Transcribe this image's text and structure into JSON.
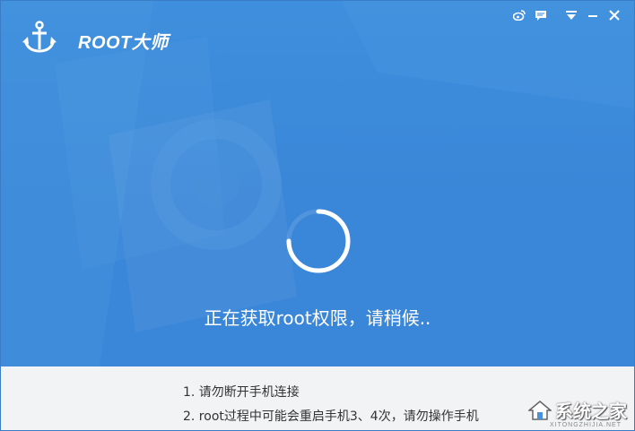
{
  "app": {
    "title": "ROOT大师"
  },
  "titlebar": {
    "controls": [
      "weibo-icon",
      "feedback-icon",
      "menu-icon",
      "minimize-icon",
      "close-icon"
    ]
  },
  "main": {
    "status_text": "正在获取root权限，请稍候.."
  },
  "tips": {
    "items": [
      "1. 请勿断开手机连接",
      "2. root过程中可能会重启手机3、4次，请勿操作手机"
    ]
  },
  "watermark": {
    "text": "系统之家",
    "sub": "XITONGZHIJIA.NET"
  },
  "colors": {
    "accent": "#3a86d8",
    "panel_bg": "#f2f3f5",
    "text_dark": "#333333"
  }
}
